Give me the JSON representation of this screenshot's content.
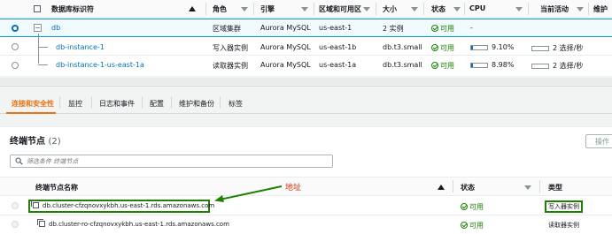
{
  "db_table": {
    "headers": {
      "identifier": "数据库标识符",
      "role": "角色",
      "engine": "引擎",
      "region": "区域和可用区",
      "size": "大小",
      "status": "状态",
      "cpu": "CPU",
      "activity": "当前活动",
      "maintenance": "维护"
    },
    "rows": [
      {
        "identifier": "db",
        "role": "区域集群",
        "engine": "Aurora MySQL",
        "region": "us-east-1",
        "size": "2 实例",
        "status": "可用",
        "cpu": "-",
        "activity": ""
      },
      {
        "identifier": "db-instance-1",
        "role": "写入器实例",
        "engine": "Aurora MySQL",
        "region": "us-east-1b",
        "size": "db.t3.small",
        "status": "可用",
        "cpu": "9.10%",
        "cpu_fraction": 0.091,
        "activity": "2 选择/秒"
      },
      {
        "identifier": "db-instance-1-us-east-1a",
        "role": "读取器实例",
        "engine": "Aurora MySQL",
        "region": "us-east-1a",
        "size": "db.t3.small",
        "status": "可用",
        "cpu": "8.98%",
        "cpu_fraction": 0.0898,
        "activity": "2 选择/秒"
      }
    ]
  },
  "tabs": [
    "连接和安全性",
    "监控",
    "日志和事件",
    "配置",
    "维护和备份",
    "标签"
  ],
  "endpoints": {
    "title": "终端节点",
    "count": "(2)",
    "actions_button": "操作",
    "filter_placeholder": "筛选条件 终端节点",
    "headers": {
      "name": "终端节点名称",
      "status": "状态",
      "type": "类型"
    },
    "rows": [
      {
        "name": "db.cluster-cfzqnovxykbh.us-east-1.rds.amazonaws.com",
        "status": "可用",
        "type": "写入器实例"
      },
      {
        "name": "db.cluster-ro-cfzqnovxykbh.us-east-1.rds.amazonaws.com",
        "status": "可用",
        "type": "读取器实例"
      }
    ]
  },
  "annotation": {
    "label": "地址",
    "color": "#1d8102",
    "label_color": "#d13212"
  },
  "colors": {
    "link": "#0073bb",
    "active_tab": "#ec7211",
    "ok": "#1d8102"
  }
}
